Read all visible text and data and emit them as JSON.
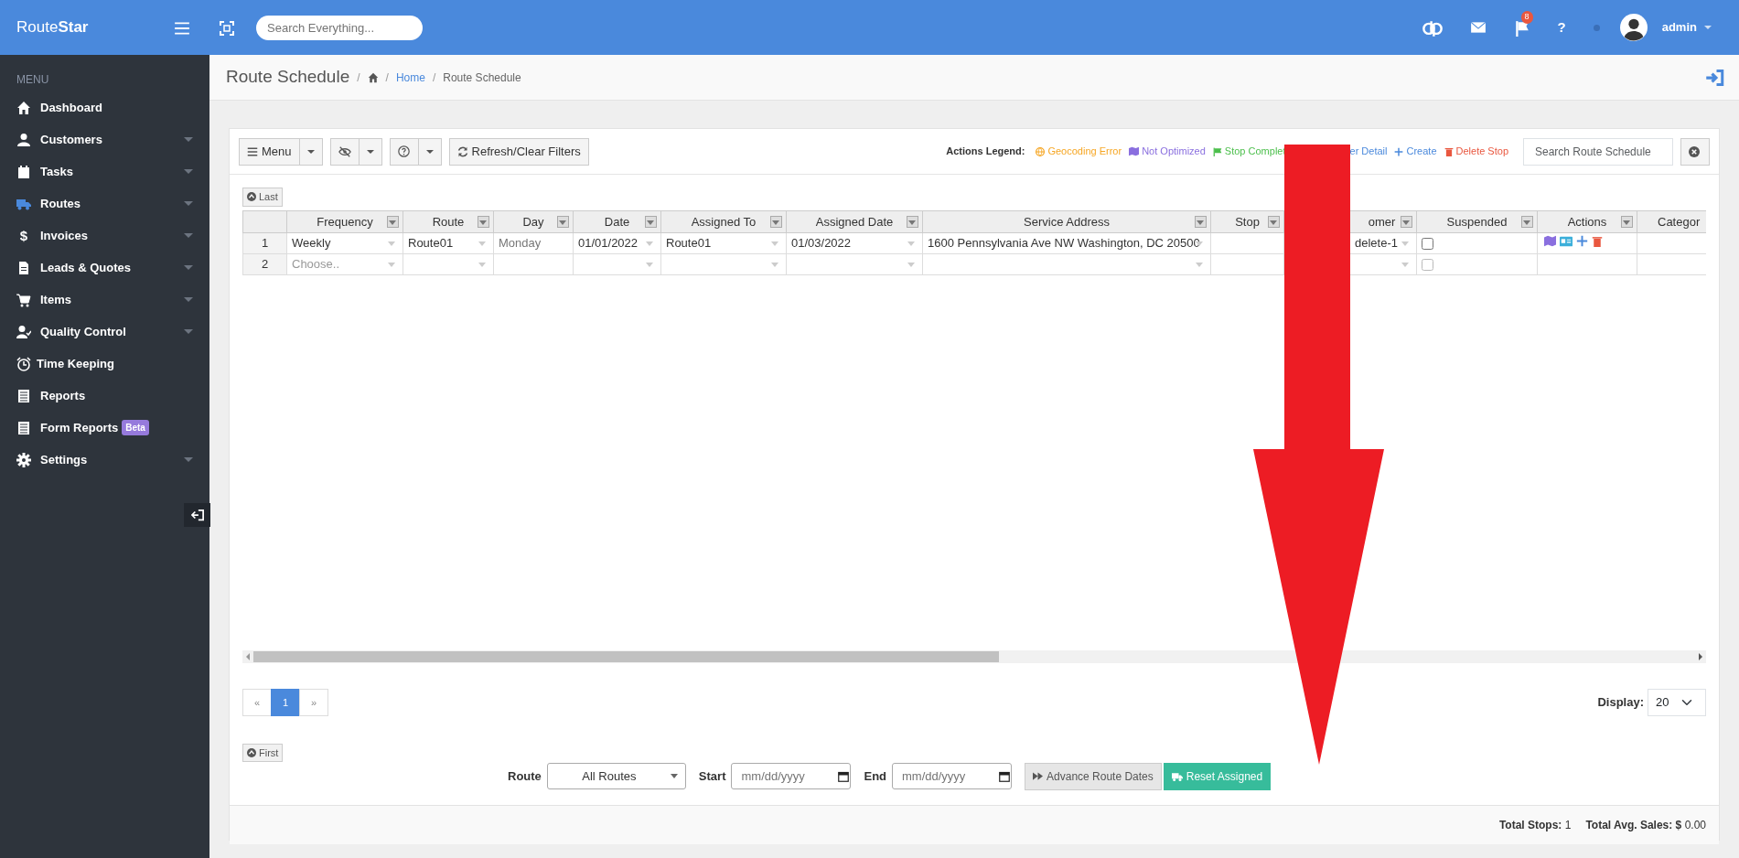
{
  "topbar": {
    "brand": "Route**Star**",
    "search_placeholder": "Search Everything...",
    "flag_count": "8",
    "help_glyph": "?",
    "user": "admin"
  },
  "sidebar": {
    "heading": "MENU",
    "items": [
      {
        "label": "Dashboard",
        "submenu": false
      },
      {
        "label": "Customers",
        "submenu": true
      },
      {
        "label": "Tasks",
        "submenu": true
      },
      {
        "label": "Routes",
        "submenu": true
      },
      {
        "label": "Invoices",
        "submenu": true,
        "glyph": "$"
      },
      {
        "label": "Leads & Quotes",
        "submenu": true
      },
      {
        "label": "Items",
        "submenu": true
      },
      {
        "label": "Quality Control",
        "submenu": true
      },
      {
        "label": "Time Keeping",
        "submenu": false
      },
      {
        "label": "Reports",
        "submenu": false
      },
      {
        "label": "Form Reports",
        "submenu": false,
        "badge": "Beta"
      },
      {
        "label": "Settings",
        "submenu": true
      }
    ]
  },
  "page": {
    "title": "Route Schedule",
    "separator": "/",
    "breadcrumb": [
      "Home",
      "Route Schedule"
    ]
  },
  "toolbar": {
    "menu_button": "Menu",
    "refresh_button": "Refresh/Clear Filters",
    "legend_label": "Actions Legend:",
    "legend": [
      {
        "text": "Geocoding Error",
        "color": "#f6a623"
      },
      {
        "text": "Not Optimized",
        "color": "#8a6fdf"
      },
      {
        "text": "Stop Complet",
        "color": "#4cbf4c"
      },
      {
        "text": "er Detail",
        "color": "#4a89dc"
      },
      {
        "text": "Create",
        "color": "#4a89dc"
      },
      {
        "text": "Delete Stop",
        "color": "#e9573f"
      }
    ],
    "search_placeholder": "Search Route Schedule"
  },
  "last_button": "Last",
  "table": {
    "columns": [
      {
        "label": "Frequency",
        "filter": true
      },
      {
        "label": "Route",
        "filter": true
      },
      {
        "label": "Day",
        "filter": true
      },
      {
        "label": "Date",
        "filter": true
      },
      {
        "label": "Assigned To",
        "filter": true
      },
      {
        "label": "Assigned Date",
        "filter": true
      },
      {
        "label": "Service Address",
        "filter": true
      },
      {
        "label": "Stop",
        "filter": true
      },
      {
        "label": "omer",
        "filter": true
      },
      {
        "label": "Suspended",
        "filter": true
      },
      {
        "label": "Actions",
        "filter": true
      },
      {
        "label": "Categor",
        "filter": false
      }
    ],
    "rows": [
      {
        "number": "1",
        "cells": [
          "Weekly",
          "Route01",
          "Monday",
          "01/01/2022",
          "Route01",
          "01/03/2022",
          "1600 Pennsylvania Ave NW Washington, DC 20500",
          null,
          "delete-1"
        ],
        "suspended": false,
        "actions": true
      },
      {
        "number": "2",
        "placeholder": "Choose..",
        "cells": [],
        "suspended": false,
        "actions": false
      }
    ]
  },
  "pagination": [
    {
      "label": "«",
      "selected": false
    },
    {
      "label": "1",
      "selected": true
    },
    {
      "label": "»",
      "selected": false
    }
  ],
  "display": {
    "label": "Display:",
    "value": "20"
  },
  "first_button": "First",
  "bottom_form": {
    "route_label": "Route",
    "route_value": "All Routes",
    "start_label": "Start",
    "start_placeholder": "mm/dd/yyyy",
    "end_label": "End",
    "end_placeholder": "mm/dd/yyyy",
    "advance_button": "Advance Route Dates",
    "reset_button": "Reset Assigned"
  },
  "footer": [
    "**Total Stops:** 1",
    "**Total Avg. Sales: $** 0.00"
  ],
  "overlay": {
    "kind": "arrow"
  }
}
